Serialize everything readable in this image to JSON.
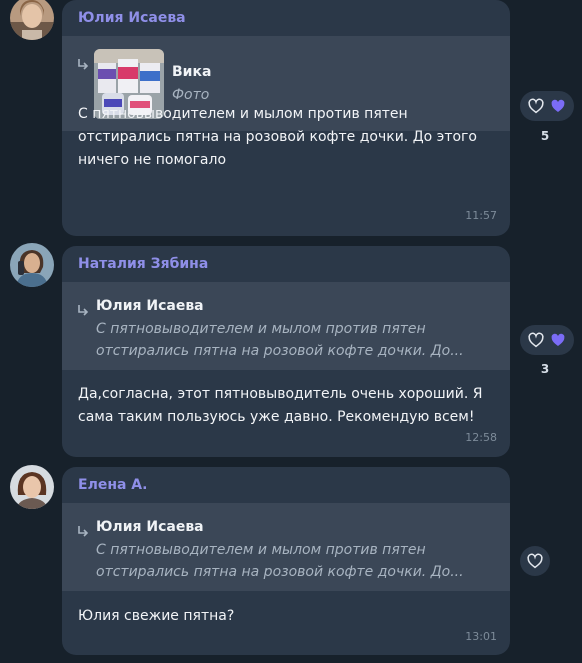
{
  "messages": [
    {
      "author": "Юлия Исаева",
      "quote": {
        "title": "Вика",
        "lines": [
          "Фото"
        ]
      },
      "text_lines": [
        "С пятновыводителем и мылом против пятен",
        "отстирались пятна на розовой кофте дочки.  До этого",
        "ничего не помогало"
      ],
      "time": "11:57",
      "reaction_count": "5",
      "icons": [
        "heart-outline-icon",
        "heart-filled-icon"
      ]
    },
    {
      "author": "Наталия Зябина",
      "quote": {
        "title": "Юлия Исаева",
        "lines": [
          "С пятновыводителем и мылом против пятен",
          "отстирались пятна на розовой кофте дочки.  До..."
        ]
      },
      "text_lines": [
        "Да,согласна, этот пятновыводитель очень хороший.  Я",
        "сама таким пользуюсь уже давно. Рекомендую всем!"
      ],
      "time": "12:58",
      "reaction_count": "3",
      "icons": [
        "heart-outline-icon",
        "heart-filled-icon"
      ]
    },
    {
      "author": "Елена А.",
      "quote": {
        "title": "Юлия Исаева",
        "lines": [
          "С пятновыводителем и мылом против пятен",
          "отстирались пятна на розовой кофте дочки.  До..."
        ]
      },
      "text_lines": [
        "Юлия свежие пятна?"
      ],
      "time": "13:01",
      "icons": [
        "heart-outline-icon"
      ]
    }
  ],
  "colors": {
    "background": "#17212b",
    "bubble": "#2b3848",
    "quote_bg": "#3b4757",
    "author_name": "#8f8fe8",
    "reaction_heart": "#7b6cf6"
  }
}
